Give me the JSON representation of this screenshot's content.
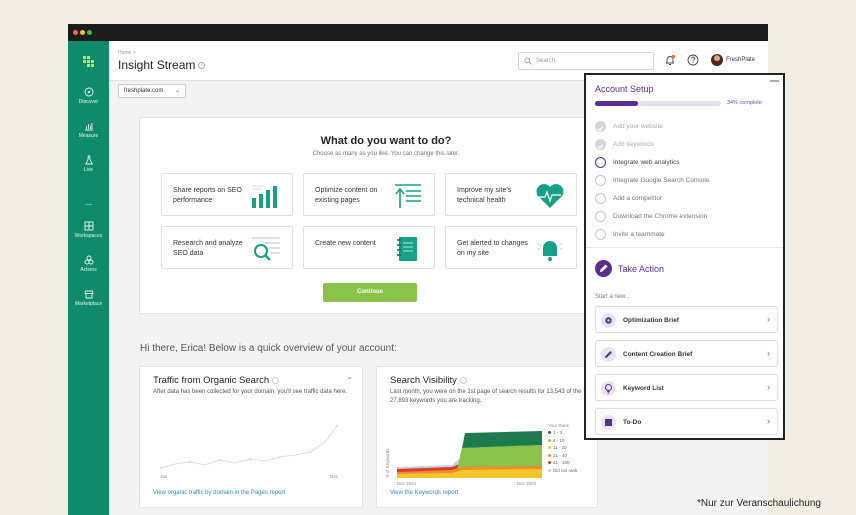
{
  "sidebar": {
    "items": [
      {
        "label": "Discover",
        "icon": "compass-icon"
      },
      {
        "label": "Measure",
        "icon": "bar-chart-icon"
      },
      {
        "label": "Live",
        "icon": "flask-icon"
      },
      {
        "label": "Workspaces",
        "icon": "grid-icon"
      },
      {
        "label": "Actions",
        "icon": "actions-icon"
      },
      {
        "label": "Marketplace",
        "icon": "store-icon"
      }
    ]
  },
  "header": {
    "breadcrumb": "Home >",
    "title": "Insight Stream",
    "search_placeholder": "Search",
    "user_name": "FreshPlate"
  },
  "domain_select": {
    "value": "freshplate.com"
  },
  "what_to_do": {
    "title": "What do you want to do?",
    "subtitle": "Choose as many as you like. You can change this later.",
    "options": [
      {
        "label": "Share reports on SEO performance",
        "icon": "report-bars-icon"
      },
      {
        "label": "Optimize content on existing pages",
        "icon": "optimize-content-icon"
      },
      {
        "label": "Improve my site's technical health",
        "icon": "heart-pulse-icon"
      },
      {
        "label": "Research and analyze SEO data",
        "icon": "magnify-data-icon"
      },
      {
        "label": "Create new content",
        "icon": "notebook-icon"
      },
      {
        "label": "Get alerted to changes on my site",
        "icon": "bell-alert-icon"
      }
    ],
    "continue_label": "Continue"
  },
  "greeting": "Hi there, Erica! Below is a quick overview of your account:",
  "traffic_card": {
    "title": "Traffic from Organic Search",
    "description": "After data has been collected for your domain, you'll see traffic data here.",
    "x_start": "Jan",
    "x_end": "Dec",
    "link": "View organic traffic by domain in the Pages report"
  },
  "visibility_card": {
    "title": "Search Visibility",
    "description": "Last month, you were on the 1st page of search results for 13,543 of the 27,893 keywords you are tracking.",
    "y_label": "# of Keywords",
    "x_start": "Dec 2021",
    "x_end": "Dec 2022",
    "legend_title": "Your Rank",
    "legend": [
      {
        "label": "1 - 3",
        "color": "#1e7b4e"
      },
      {
        "label": "4 - 10",
        "color": "#8bc34a"
      },
      {
        "label": "11 - 20",
        "color": "#f3c623"
      },
      {
        "label": "21 - 40",
        "color": "#f08c2e"
      },
      {
        "label": "41 - 100",
        "color": "#d83a3a"
      },
      {
        "label": "Did not rank",
        "color": "#cfcfcf"
      }
    ],
    "link": "View the Keywords report"
  },
  "account_setup": {
    "title": "Account Setup",
    "progress": 0.34,
    "progress_label": "34% complete",
    "steps": [
      {
        "label": "Add your website",
        "done": true
      },
      {
        "label": "Add keywords",
        "done": true
      },
      {
        "label": "Integrate web analytics",
        "done": false,
        "active": true
      },
      {
        "label": "Integrate Google Search Console",
        "done": false
      },
      {
        "label": "Add a competitor",
        "done": false
      },
      {
        "label": "Download the Chrome extension",
        "done": false
      },
      {
        "label": "Invite a teammate",
        "done": false
      }
    ]
  },
  "take_action": {
    "title": "Take Action",
    "start_new": "Start a new...",
    "items": [
      {
        "label": "Optimization Brief",
        "icon": "gear-icon"
      },
      {
        "label": "Content Creation Brief",
        "icon": "pencil-icon"
      },
      {
        "label": "Keyword List",
        "icon": "lightbulb-icon"
      },
      {
        "label": "To-Do",
        "icon": "note-icon"
      }
    ]
  },
  "footnote": "*Nur zur Veranschaulichung",
  "colors": {
    "brand_green": "#0f8b6c",
    "accent_purple": "#5a2d91",
    "continue_green": "#8bc34a",
    "link_blue": "#2a8bd2"
  }
}
